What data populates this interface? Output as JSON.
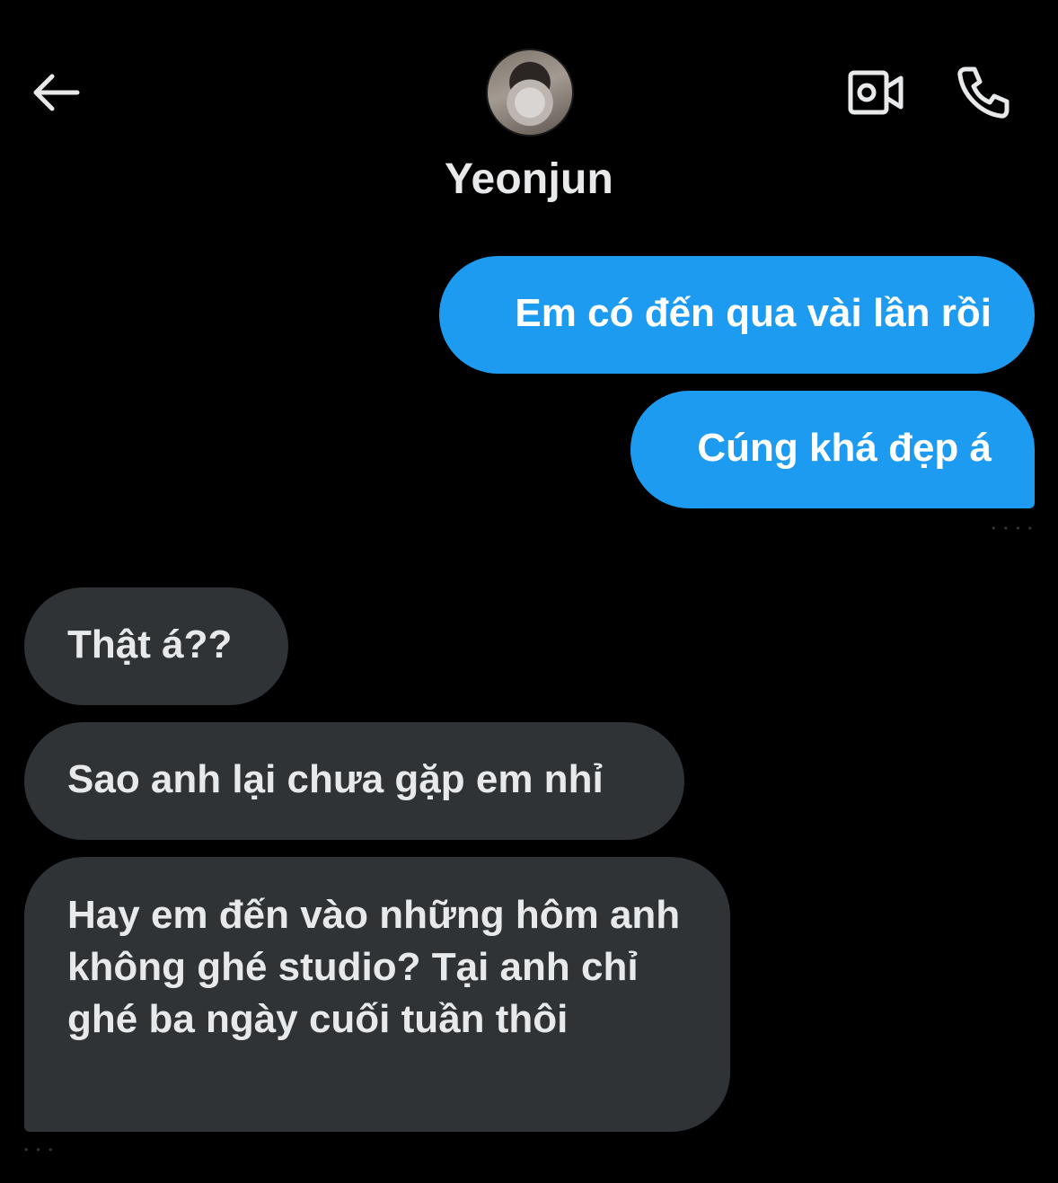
{
  "header": {
    "contact_name": "Yeonjun",
    "icons": {
      "back": "arrow-left-icon",
      "video": "video-camera-icon",
      "phone": "phone-icon"
    }
  },
  "colors": {
    "background": "#000000",
    "sent_bubble": "#1d9bf0",
    "received_bubble": "#2f3336",
    "text": "#e7e9ea"
  },
  "messages": [
    {
      "direction": "sent",
      "text": "Em có đến qua vài lần rồi"
    },
    {
      "direction": "sent",
      "text": "Cúng khá đẹp á"
    },
    {
      "direction": "received",
      "text": "Thật á??"
    },
    {
      "direction": "received",
      "text": "Sao anh lại chưa gặp em nhỉ"
    },
    {
      "direction": "received",
      "text": "Hay em đến vào những hôm anh không ghé studio? Tại anh chỉ ghé ba ngày cuối tuần thôi"
    }
  ]
}
